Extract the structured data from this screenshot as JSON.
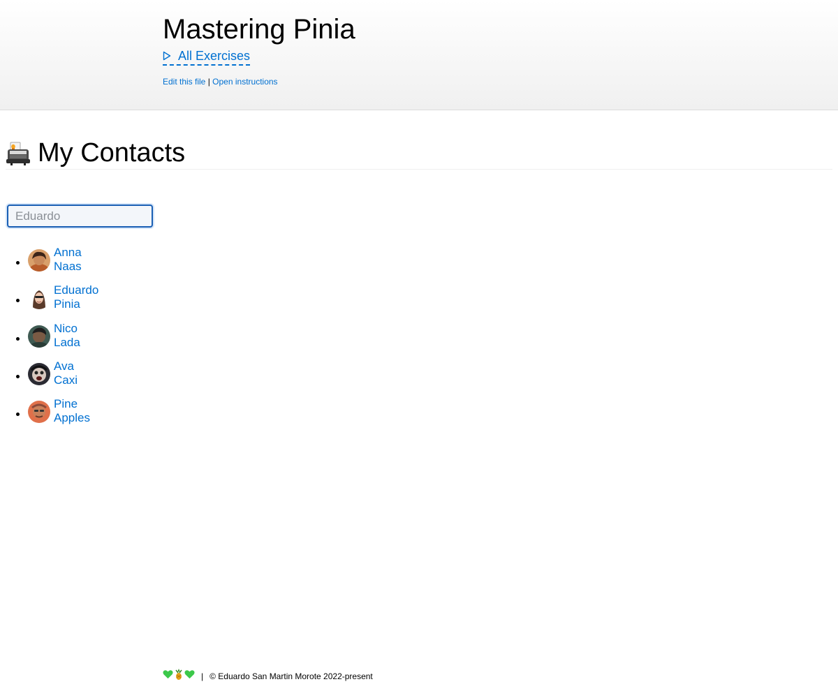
{
  "header": {
    "site_title": "Mastering Pinia",
    "exercises_link": "All Exercises",
    "edit_link": "Edit this file",
    "link_separator": "|",
    "instructions_link": "Open instructions"
  },
  "main": {
    "title": "My Contacts",
    "title_icon": "rolodex-icon",
    "search": {
      "value": "",
      "placeholder": "Eduardo"
    },
    "contacts": [
      {
        "name": "Anna Naas",
        "avatar": "avatar-photo"
      },
      {
        "name": "Eduardo Pinia",
        "avatar": "avatar-photo"
      },
      {
        "name": "Nico Lada",
        "avatar": "avatar-photo"
      },
      {
        "name": "Ava Caxi",
        "avatar": "avatar-photo"
      },
      {
        "name": "Pine Apples",
        "avatar": "avatar-photo"
      }
    ]
  },
  "footer": {
    "icons": [
      "green-heart-icon",
      "pineapple-icon",
      "green-heart-icon"
    ],
    "separator": "|",
    "copyright": "© Eduardo San Martin Morote 2022-present"
  },
  "colors": {
    "link": "#0070d1",
    "input_border": "#1a5fb4",
    "input_background": "#f3f6fa",
    "header_background": "#f0f0f0"
  }
}
